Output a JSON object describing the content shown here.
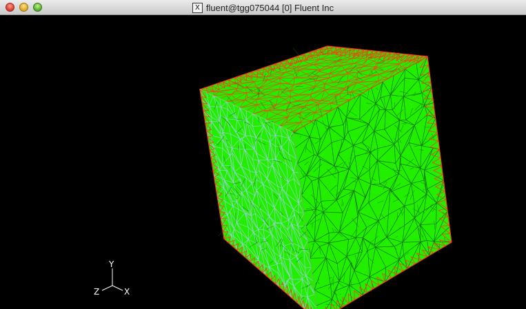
{
  "window": {
    "title": "fluent@tgg075044 [0] Fluent Inc",
    "x_server_badge": "X"
  },
  "colors": {
    "background": "#000000",
    "mesh_fill": "#22ee00",
    "edge_mesh": "#ff3a1a",
    "side_mesh": "#b0c8ff",
    "axes": "#ffffff"
  },
  "axes_triad": {
    "x_label": "X",
    "y_label": "Y",
    "z_label": "Z"
  }
}
